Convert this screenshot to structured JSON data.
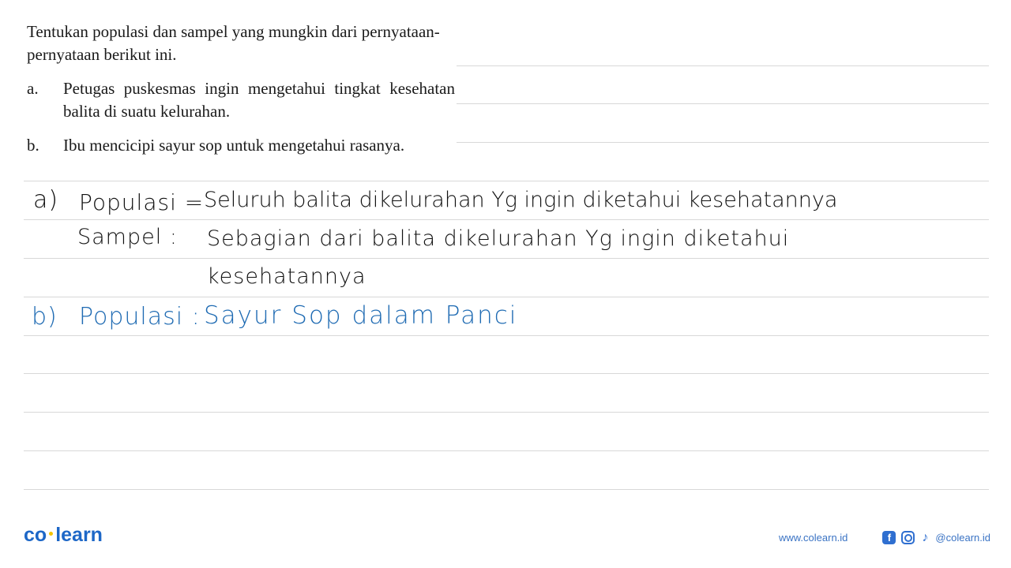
{
  "question": {
    "intro": "Tentukan populasi dan sampel yang mungkin dari pernyataan-pernyataan berikut ini.",
    "items": [
      {
        "label": "a.",
        "text": "Petugas puskesmas ingin mengetahui tingkat kesehatan balita di suatu kelurahan."
      },
      {
        "label": "b.",
        "text": "Ibu mencicipi sayur sop untuk mengetahui rasanya."
      }
    ]
  },
  "answer": {
    "a_label": "a)",
    "a_populasi_label": "Populasi =",
    "a_populasi_text": "Seluruh balita dikelurahan Yg ingin diketahui kesehatannya",
    "a_sampel_label": "Sampel :",
    "a_sampel_text": "Sebagian dari balita dikelurahan Yg ingin diketahui",
    "a_sampel_text_cont": "kesehatannya",
    "b_label": "b)",
    "b_populasi_label": "Populasi :",
    "b_populasi_text": "Sayur Sop dalam Panci"
  },
  "colors": {
    "handwriting_black": "#111111",
    "handwriting_blue": "#1f6bb3",
    "brand": "#1d67c7",
    "brand_dot": "#f5c400"
  },
  "footer": {
    "logo_left": "co",
    "logo_right": "learn",
    "website": "www.colearn.id",
    "social_handle": "@colearn.id",
    "icons": [
      "facebook-icon",
      "instagram-icon",
      "tiktok-icon"
    ]
  }
}
